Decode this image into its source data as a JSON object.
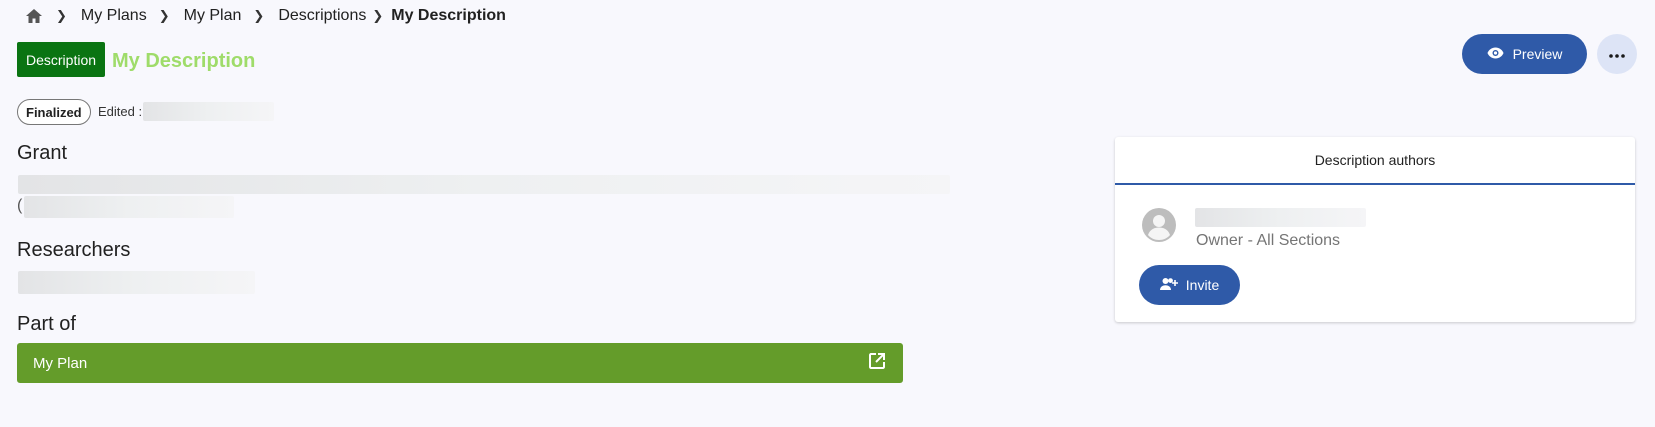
{
  "breadcrumb": {
    "items": [
      "My Plans",
      "My Plan",
      "Descriptions"
    ],
    "current": "My Description"
  },
  "header": {
    "type_badge": "Description",
    "title": "My Description",
    "preview_label": "Preview"
  },
  "status": {
    "chip": "Finalized",
    "edited_label": "Edited :"
  },
  "sections": {
    "grant_label": "Grant",
    "researchers_label": "Researchers",
    "part_of_label": "Part of",
    "part_of_plan": "My Plan"
  },
  "authors": {
    "tab_label": "Description authors",
    "owner_role": "Owner - All Sections",
    "invite_label": "Invite"
  },
  "colors": {
    "accent": "#2f5aa8",
    "badge": "#0a7412",
    "title": "#9fdc6a",
    "plan_link": "#649c2a"
  },
  "icons": [
    "home-icon",
    "eye-icon",
    "more-horiz-icon",
    "open-in-new-icon",
    "account-circle-icon",
    "group-add-icon"
  ]
}
